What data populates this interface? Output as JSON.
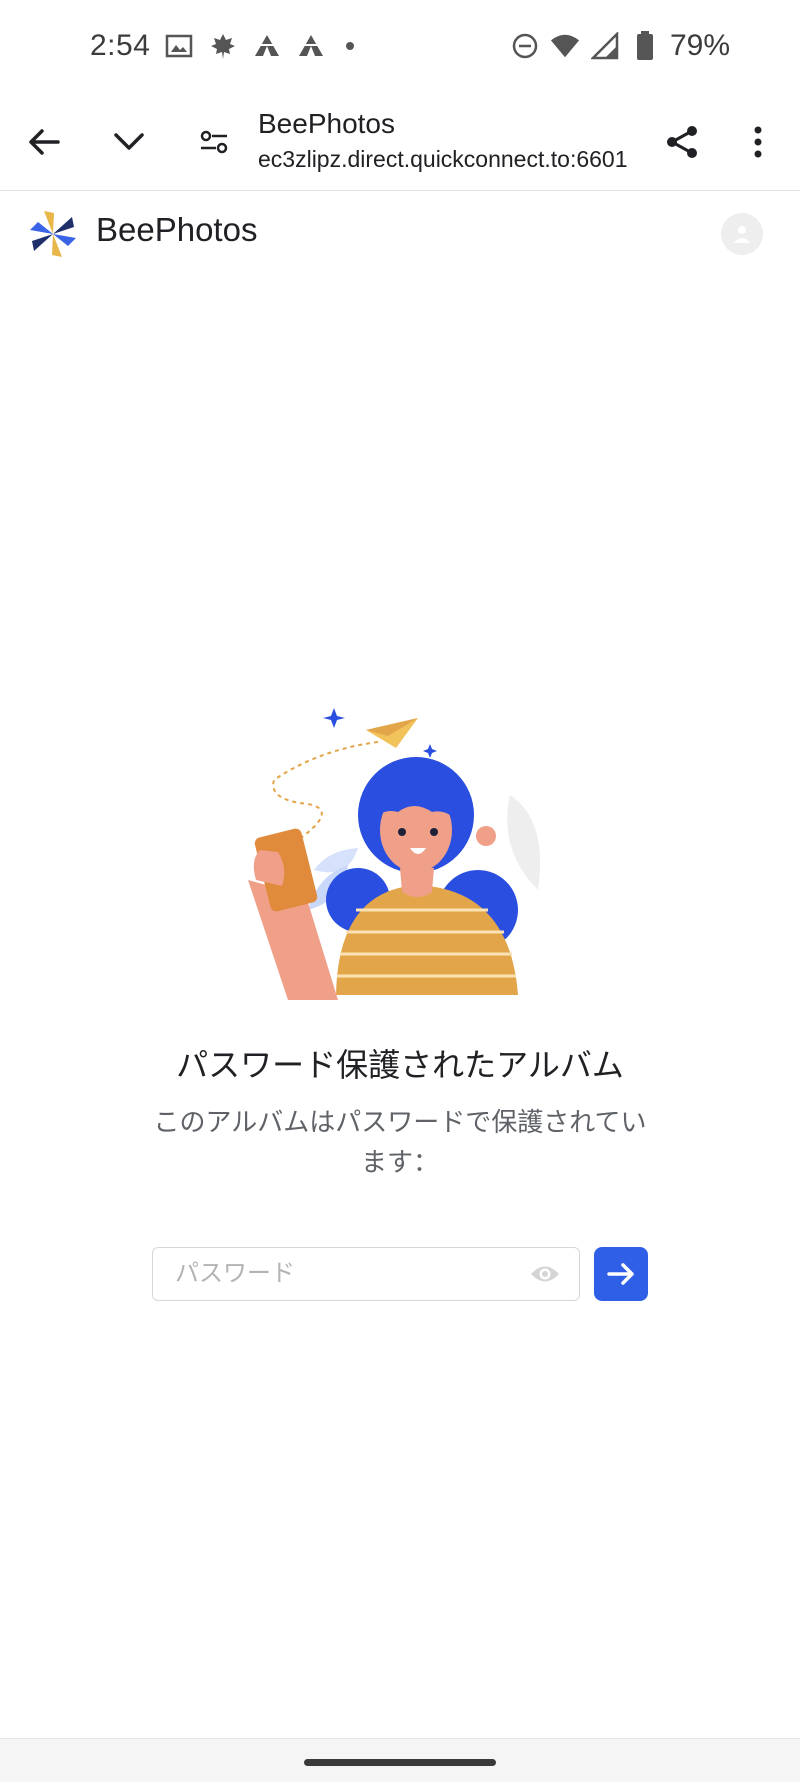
{
  "status_bar": {
    "time": "2:54",
    "battery": "79%",
    "icons": [
      "gallery-icon",
      "maple-leaf-icon",
      "tent-icon",
      "tent-icon",
      "dot-icon",
      "do-not-disturb-icon",
      "wifi-icon",
      "signal-icon",
      "battery-icon"
    ]
  },
  "browser": {
    "page_title": "BeePhotos",
    "url": "ec3zlipz.direct.quickconnect.to:6601"
  },
  "app": {
    "name": "BeePhotos"
  },
  "album": {
    "title": "パスワード保護されたアルバム",
    "description": "このアルバムはパスワードで保護されています："
  },
  "password": {
    "placeholder": "パスワード",
    "value": ""
  },
  "colors": {
    "accent": "#2f5fe6",
    "hair": "#2a4fe0",
    "shirt": "#e2a54a",
    "skin": "#f0a089",
    "phone": "#e08a3c"
  }
}
